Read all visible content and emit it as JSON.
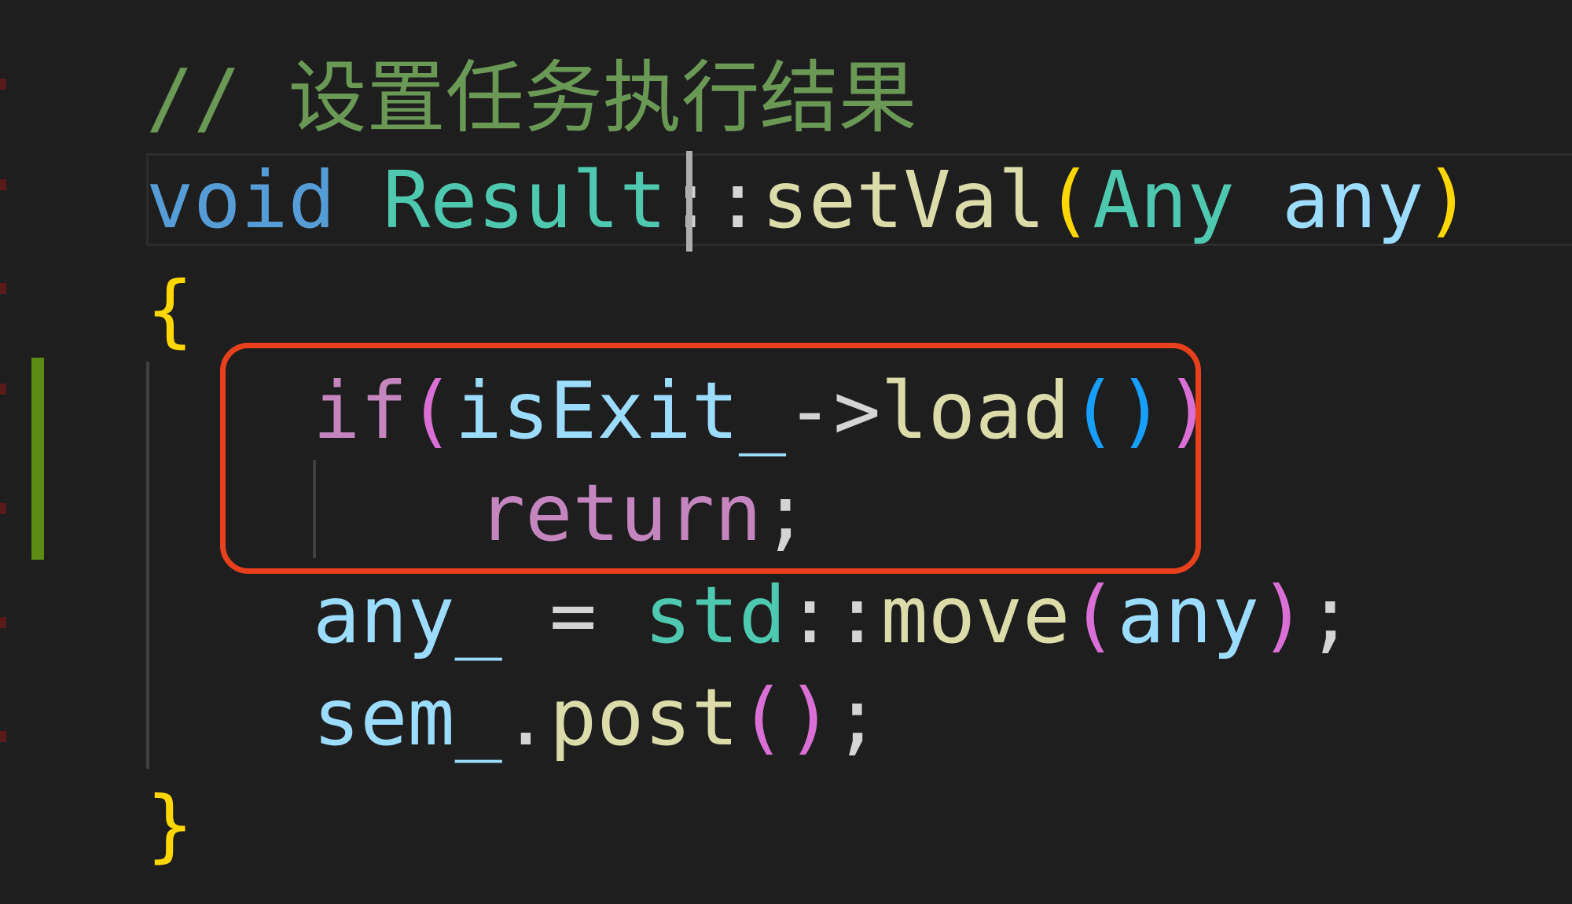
{
  "editor": {
    "colors": {
      "background": "#1e1e1e",
      "comment": "#6a9955",
      "keyword": "#569cd6",
      "type": "#4ec9b0",
      "function": "#dcdcaa",
      "variable": "#9cdcfe",
      "control": "#c586c0",
      "bracket_gold": "#ffd700",
      "bracket_pink": "#da70d6",
      "bracket_blue": "#179fff",
      "highlight_box": "#e8401c",
      "gutter_modified": "#5d8c15"
    },
    "lines": {
      "comment": "// 设置任务执行结果",
      "signature": {
        "kw_void": "void",
        "class_name": "Result",
        "scope": "::",
        "method": "setVal",
        "paren_open": "(",
        "param_type": "Any",
        "param_name": "any",
        "paren_close": ")"
      },
      "brace_open": "{",
      "if_line": {
        "kw_if": "if",
        "paren_open": "(",
        "var": "isExit_",
        "arrow": "->",
        "call": "load",
        "call_open": "(",
        "call_close": ")",
        "paren_close": ")"
      },
      "return_line": {
        "kw_return": "return",
        "semicolon": ";"
      },
      "assign_line": {
        "lhs": "any_",
        "op": " = ",
        "ns": "std",
        "scope": "::",
        "func": "move",
        "paren_open": "(",
        "arg": "any",
        "paren_close": ")",
        "semicolon": ";"
      },
      "post_line": {
        "obj": "sem_",
        "dot": ".",
        "func": "post",
        "paren_open": "(",
        "paren_close": ")",
        "semicolon": ";"
      },
      "brace_close": "}"
    }
  }
}
